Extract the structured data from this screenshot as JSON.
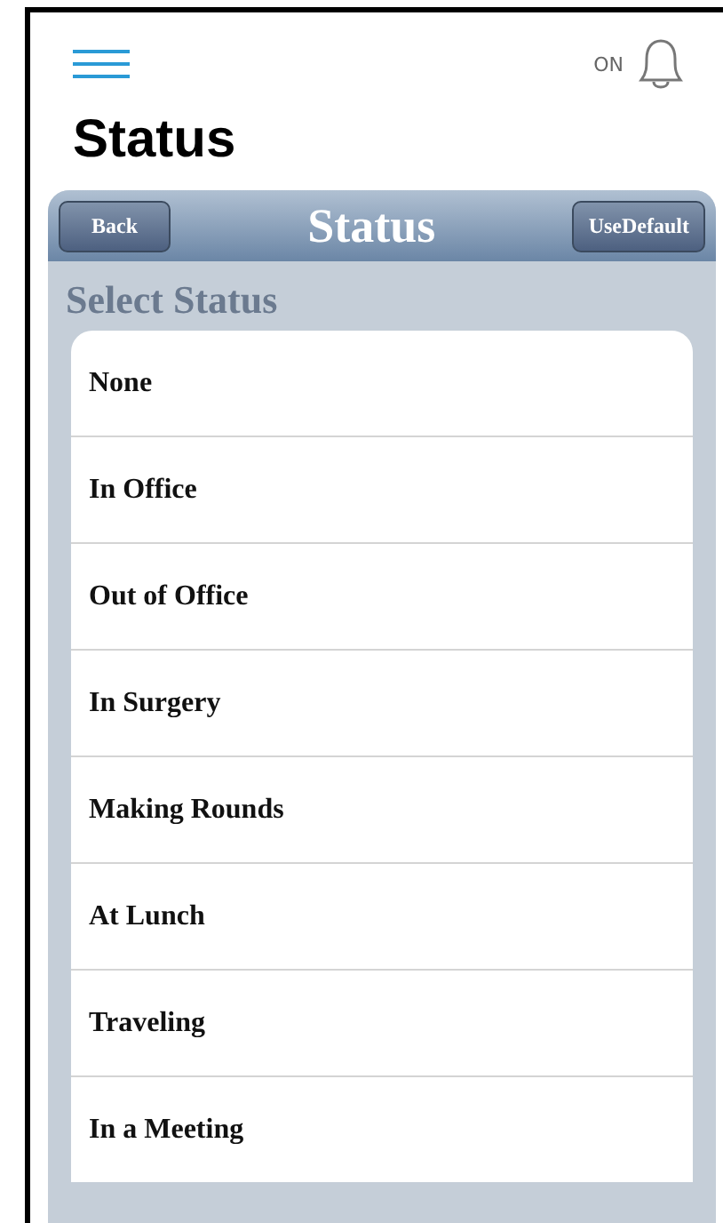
{
  "header": {
    "notification_label": "ON",
    "title": "Status"
  },
  "navbar": {
    "back": "Back",
    "title": "Status",
    "action": "UseDefault"
  },
  "section_title": "Select Status",
  "statuses": [
    "None",
    "In Office",
    "Out of Office",
    "In Surgery",
    "Making Rounds",
    "At Lunch",
    "Traveling",
    "In a Meeting"
  ]
}
